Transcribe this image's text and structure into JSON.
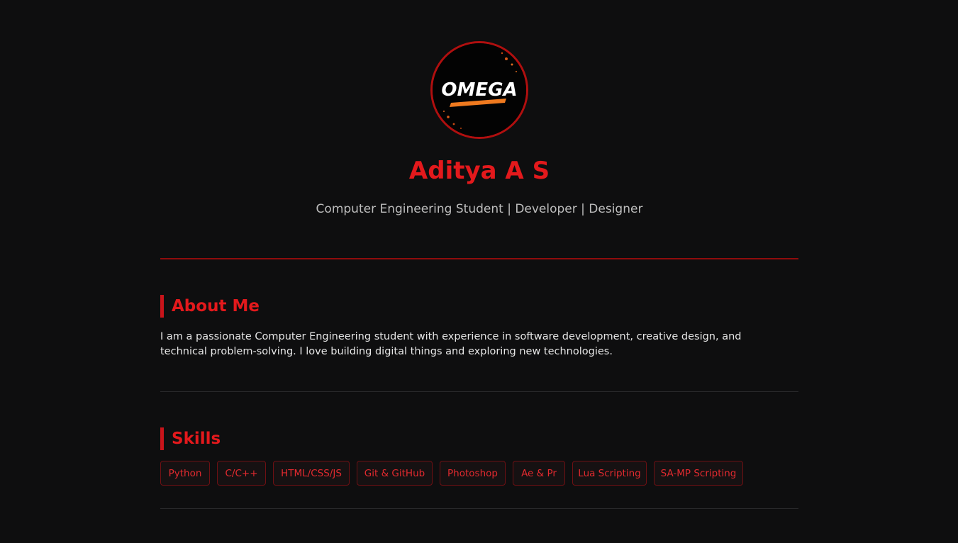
{
  "profile": {
    "logo_text": "OMEGA",
    "name": "Aditya A S",
    "tagline": "Computer Engineering Student | Developer | Designer"
  },
  "about": {
    "title": "About Me",
    "text": "I am a passionate Computer Engineering student with experience in software development, creative design, and technical problem-solving. I love building digital things and exploring new technologies."
  },
  "skills": {
    "title": "Skills",
    "items": [
      "Python",
      "C/C++",
      "HTML/CSS/JS",
      "Git & GitHub",
      "Photoshop",
      "Ae & Pr",
      "Lua Scripting",
      "SA-MP Scripting"
    ]
  },
  "colors": {
    "background": "#0e0e0f",
    "accent": "#e3191c",
    "accent_dark": "#8f0c0c",
    "logo_orange": "#f07a1f"
  }
}
